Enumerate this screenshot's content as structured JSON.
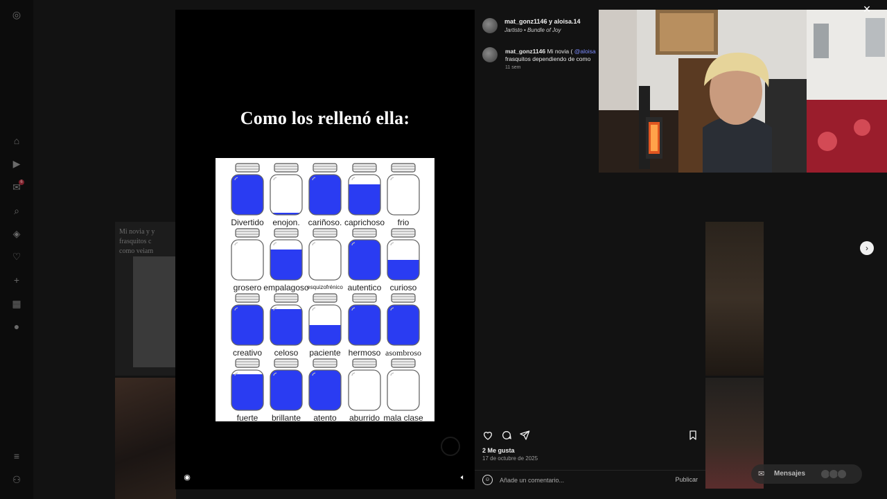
{
  "rail": {
    "items": [
      {
        "name": "instagram-logo-icon",
        "glyph": "◎"
      },
      {
        "name": "home-icon",
        "glyph": "⌂"
      },
      {
        "name": "reels-icon",
        "glyph": "▶"
      },
      {
        "name": "messages-icon",
        "glyph": "✉",
        "badge": "6"
      },
      {
        "name": "search-icon",
        "glyph": "⌕"
      },
      {
        "name": "explore-icon",
        "glyph": "◈"
      },
      {
        "name": "notifications-icon",
        "glyph": "♡"
      },
      {
        "name": "create-icon",
        "glyph": "+"
      },
      {
        "name": "dashboard-icon",
        "glyph": "▦"
      },
      {
        "name": "profile-icon",
        "glyph": "●"
      },
      {
        "name": "menu-icon",
        "glyph": "≡"
      },
      {
        "name": "more-icon",
        "glyph": "⚇"
      }
    ]
  },
  "background_post": {
    "text_lines": [
      "Mi novia y y",
      "frasquitos c",
      "como veiam"
    ]
  },
  "post": {
    "title": "Como los rellenó ella:",
    "jar_color": "#2a3cf2",
    "jars": [
      {
        "label": "Divertido",
        "fill": 1.0
      },
      {
        "label": "enojon.",
        "fill": 0.05
      },
      {
        "label": "cariñoso.",
        "fill": 1.0
      },
      {
        "label": "caprichoso",
        "fill": 0.75
      },
      {
        "label": "frio",
        "fill": 0.0
      },
      {
        "label": "grosero",
        "fill": 0.0
      },
      {
        "label": "empalagoso",
        "fill": 0.75
      },
      {
        "label": "esquizofrénico",
        "fill": 0.0,
        "small": true
      },
      {
        "label": "autentico",
        "fill": 1.0
      },
      {
        "label": "curioso",
        "fill": 0.5
      },
      {
        "label": "creativo",
        "fill": 1.0
      },
      {
        "label": "celoso",
        "fill": 0.9
      },
      {
        "label": "paciente",
        "fill": 0.5
      },
      {
        "label": "hermoso",
        "fill": 1.0
      },
      {
        "label": "asombroso",
        "fill": 1.0,
        "serif": true
      },
      {
        "label": "fuerte",
        "fill": 0.9
      },
      {
        "label": "brillante",
        "fill": 1.0
      },
      {
        "label": "atento",
        "fill": 1.0
      },
      {
        "label": "aburrido",
        "fill": 0.0
      },
      {
        "label": "mala clase",
        "fill": 0.0
      }
    ]
  },
  "panel": {
    "author": "mat_gonz1146 y aloisa.14",
    "audio": "Jartisto • Bundle of Joy",
    "caption_user": "mat_gonz1146",
    "caption_text": "Mi novia (",
    "caption_mention": "@aloisa",
    "caption_line2": "frasquitos dependiendo de como",
    "caption_age": "11 sem",
    "likes": "2 Me gusta",
    "date": "17 de octubre de 2025",
    "comment_placeholder": "Añade un comentario...",
    "publish_label": "Publicar"
  },
  "overlay": {
    "messages_label": "Mensajes"
  }
}
